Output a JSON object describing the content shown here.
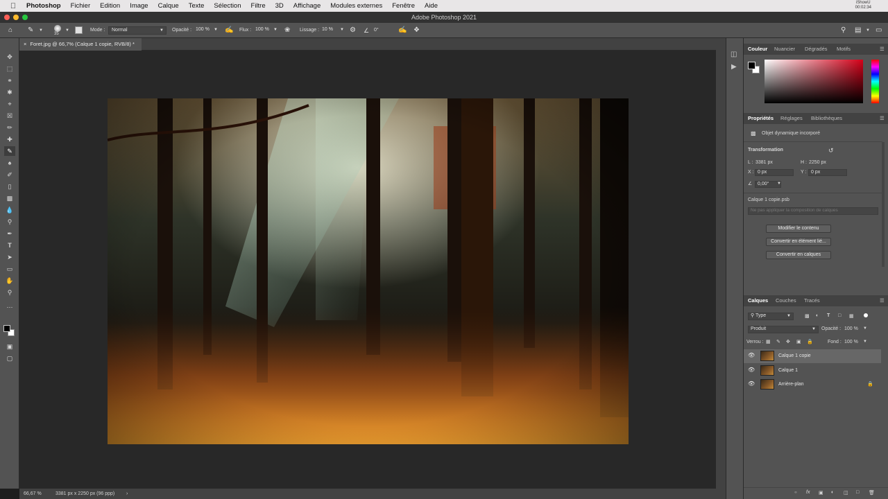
{
  "menubar": {
    "items": [
      "Photoshop",
      "Fichier",
      "Edition",
      "Image",
      "Calque",
      "Texte",
      "Sélection",
      "Filtre",
      "3D",
      "Affichage",
      "Modules externes",
      "Fenêtre",
      "Aide"
    ],
    "clock_user": "iShowU",
    "clock_time": "00:02:34"
  },
  "window": {
    "title": "Adobe Photoshop 2021"
  },
  "options": {
    "brush_size": "35",
    "mode_label": "Mode :",
    "mode_value": "Normal",
    "opacity_label": "Opacité :",
    "opacity_value": "100 %",
    "flow_label": "Flux :",
    "flow_value": "100 %",
    "smoothing_label": "Lissage :",
    "smoothing_value": "10 %",
    "angle_value": "0°"
  },
  "document": {
    "tab_label": "Foret.jpg @ 66,7% (Calque 1 copie, RVB/8) *"
  },
  "status": {
    "zoom": "66,67 %",
    "doc_info": "3381 px x 2250 px (96 ppp)"
  },
  "color_panel": {
    "tabs": [
      "Couleur",
      "Nuancier",
      "Dégradés",
      "Motifs"
    ],
    "active": "Couleur",
    "hue_color": "#d40018"
  },
  "properties_panel": {
    "tabs": [
      "Propriétés",
      "Réglages",
      "Bibliothèques"
    ],
    "object_type": "Objet dynamique incorporé",
    "transformation_label": "Transformation",
    "w_label": "L :",
    "w_value": "3381 px",
    "h_label": "H :",
    "h_value": "2250 px",
    "x_label": "X :",
    "x_value": "0 px",
    "y_label": "Y :",
    "y_value": "0 px",
    "angle_value": "0,00°",
    "file_name": "Calque 1 copie.psb",
    "composition_placeholder": "Ne pas appliquer la composition de calques",
    "buttons": [
      "Modifier le contenu",
      "Convertir en élément lié...",
      "Convertir en calques"
    ]
  },
  "layers_panel": {
    "tabs": [
      "Calques",
      "Couches",
      "Tracés"
    ],
    "filter_value": "Type",
    "blend_mode": "Produit",
    "opacity_label": "Opacité :",
    "opacity_value": "100 %",
    "lock_label": "Verrou :",
    "fill_label": "Fond :",
    "fill_value": "100 %",
    "layers": [
      {
        "name": "Calque 1 copie",
        "selected": true
      },
      {
        "name": "Calque 1",
        "selected": false
      },
      {
        "name": "Arrière-plan",
        "selected": false
      }
    ]
  }
}
